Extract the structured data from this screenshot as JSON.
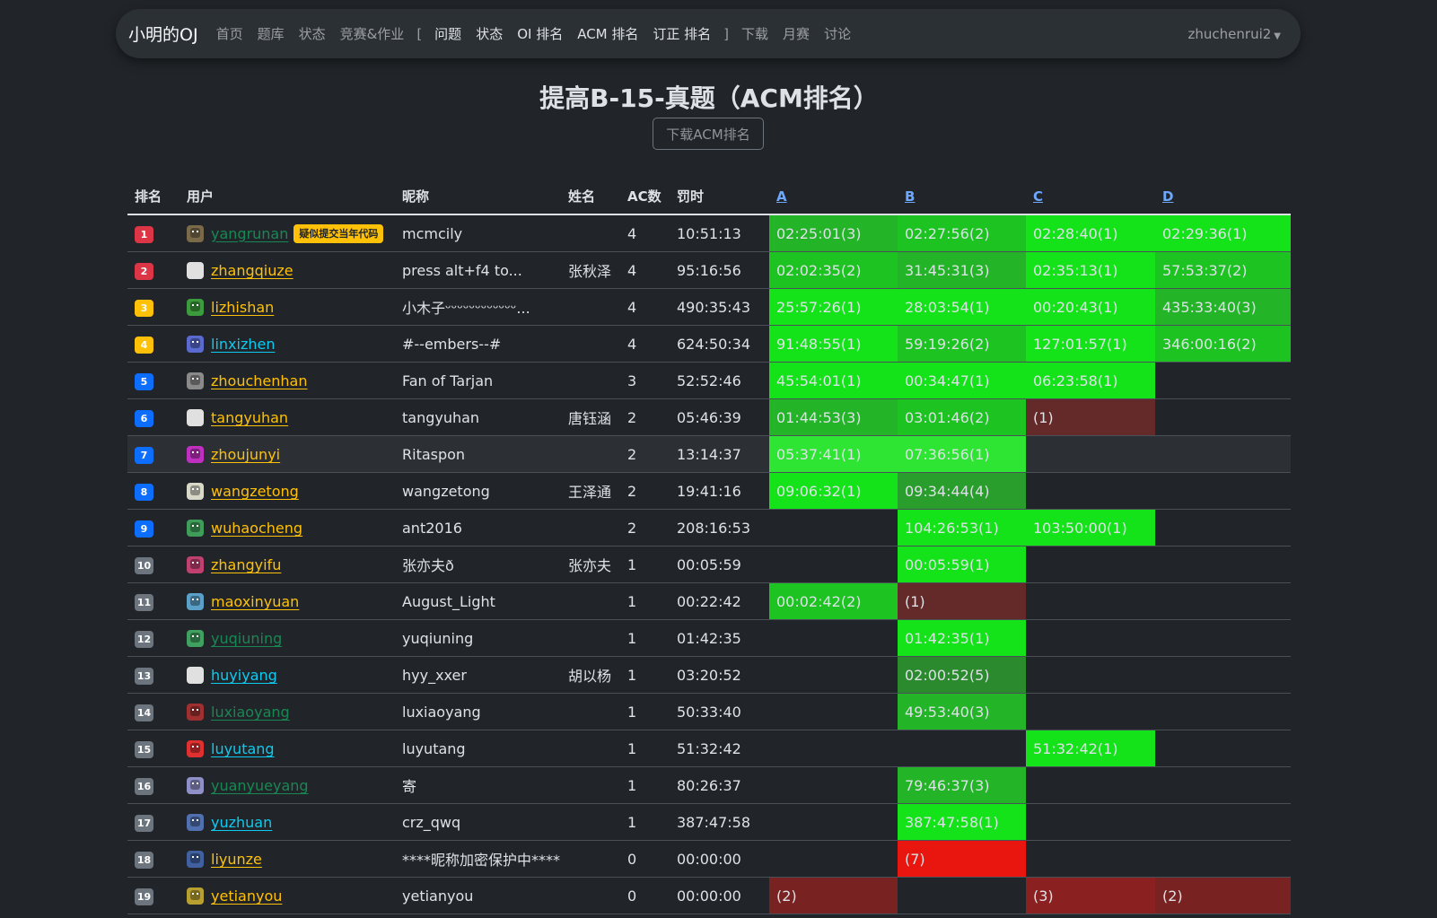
{
  "nav": {
    "brand": "小明的OJ",
    "items": [
      {
        "label": "首页",
        "strong": false
      },
      {
        "label": "题库",
        "strong": false
      },
      {
        "label": "状态",
        "strong": false
      },
      {
        "label": "竞赛&作业",
        "strong": false
      },
      {
        "label": "[",
        "bracket": true
      },
      {
        "label": "问题",
        "strong": true
      },
      {
        "label": "状态",
        "strong": true
      },
      {
        "label": "OI 排名",
        "strong": true
      },
      {
        "label": "ACM 排名",
        "strong": true
      },
      {
        "label": "订正 排名",
        "strong": true
      },
      {
        "label": "]",
        "bracket": true
      },
      {
        "label": "下载",
        "strong": false
      },
      {
        "label": "月赛",
        "strong": false
      },
      {
        "label": "讨论",
        "strong": false
      }
    ],
    "user": "zhuchenrui2"
  },
  "page": {
    "title": "提高B-15-真题（ACM排名）",
    "download_label": "下载ACM排名"
  },
  "table": {
    "headers": {
      "rank": "排名",
      "user": "用户",
      "nick": "昵称",
      "name": "姓名",
      "ac": "AC数",
      "penalty": "罚时"
    },
    "problems": [
      "A",
      "B",
      "C",
      "D"
    ],
    "rows": [
      {
        "rank": "1",
        "user": "yangrunan",
        "ucolor": "#198754",
        "avatar": "#7a6a4a",
        "flag": "疑似提交当年代码",
        "nick": "mcmcily",
        "name": "",
        "ac": "4",
        "pen": "10:51:13",
        "cells": [
          {
            "t": "02:25:01(3)",
            "c": "#23b428"
          },
          {
            "t": "02:27:56(2)",
            "c": "#1cc321"
          },
          {
            "t": "02:28:40(1)",
            "c": "#14e31a"
          },
          {
            "t": "02:29:36(1)",
            "c": "#14e31a"
          }
        ]
      },
      {
        "rank": "2",
        "user": "zhangqiuze",
        "ucolor": "#ffc107",
        "avatar": "#e0e0e0",
        "avatarPlain": true,
        "nick": "press alt+f4 to...",
        "name": "张秋泽",
        "ac": "4",
        "pen": "95:16:56",
        "cells": [
          {
            "t": "02:02:35(2)",
            "c": "#1cc321"
          },
          {
            "t": "31:45:31(3)",
            "c": "#23b428"
          },
          {
            "t": "02:35:13(1)",
            "c": "#14e31a"
          },
          {
            "t": "57:53:37(2)",
            "c": "#1cc321"
          }
        ]
      },
      {
        "rank": "3",
        "user": "lizhishan",
        "ucolor": "#ffc107",
        "avatar": "#3c9b3c",
        "nick": "小木子ᵕᵕᵕᵕᵕᵕᵕᵕᵕᵕᵕᵕ...",
        "name": "",
        "ac": "4",
        "pen": "490:35:43",
        "cells": [
          {
            "t": "25:57:26(1)",
            "c": "#14e31a"
          },
          {
            "t": "28:03:54(1)",
            "c": "#14e31a"
          },
          {
            "t": "00:20:43(1)",
            "c": "#14e31a"
          },
          {
            "t": "435:33:40(3)",
            "c": "#23b428"
          }
        ]
      },
      {
        "rank": "4",
        "user": "linxizhen",
        "ucolor": "#0dcaf0",
        "avatar": "#5a6ad0",
        "nick": "#--embers--#",
        "name": "",
        "ac": "4",
        "pen": "624:50:34",
        "cells": [
          {
            "t": "91:48:55(1)",
            "c": "#14e31a"
          },
          {
            "t": "59:19:26(2)",
            "c": "#1cc321"
          },
          {
            "t": "127:01:57(1)",
            "c": "#14e31a"
          },
          {
            "t": "346:00:16(2)",
            "c": "#1cc321"
          }
        ]
      },
      {
        "rank": "5",
        "user": "zhouchenhan",
        "ucolor": "#ffc107",
        "avatar": "#8a8a8a",
        "nick": "Fan of Tarjan",
        "name": "",
        "ac": "3",
        "pen": "52:52:46",
        "cells": [
          {
            "t": "45:54:01(1)",
            "c": "#14e31a"
          },
          {
            "t": "00:34:47(1)",
            "c": "#14e31a"
          },
          {
            "t": "06:23:58(1)",
            "c": "#14e31a"
          },
          {
            "t": "",
            "c": ""
          }
        ]
      },
      {
        "rank": "6",
        "user": "tangyuhan",
        "ucolor": "#ffc107",
        "avatar": "#e0e0e0",
        "avatarPlain": true,
        "nick": "tangyuhan",
        "name": "唐钰涵",
        "ac": "2",
        "pen": "05:46:39",
        "cells": [
          {
            "t": "01:44:53(3)",
            "c": "#23b428"
          },
          {
            "t": "03:01:46(2)",
            "c": "#1cc321"
          },
          {
            "t": "(1)",
            "c": "#642a2a"
          },
          {
            "t": "",
            "c": ""
          }
        ]
      },
      {
        "rank": "7",
        "user": "zhoujunyi",
        "ucolor": "#ffc107",
        "avatar": "#c030c0",
        "hl": true,
        "nick": "Ritaspon",
        "name": "",
        "ac": "2",
        "pen": "13:14:37",
        "cells": [
          {
            "t": "05:37:41(1)",
            "c": "#2ee533"
          },
          {
            "t": "07:36:56(1)",
            "c": "#2ee533"
          },
          {
            "t": "",
            "c": ""
          },
          {
            "t": "",
            "c": ""
          }
        ]
      },
      {
        "rank": "8",
        "user": "wangzetong",
        "ucolor": "#ffc107",
        "avatar": "#d8d8c8",
        "nick": "wangzetong",
        "name": "王泽通",
        "ac": "2",
        "pen": "19:41:16",
        "cells": [
          {
            "t": "09:06:32(1)",
            "c": "#14e31a"
          },
          {
            "t": "09:34:44(4)",
            "c": "#2a9e2d"
          },
          {
            "t": "",
            "c": ""
          },
          {
            "t": "",
            "c": ""
          }
        ]
      },
      {
        "rank": "9",
        "user": "wuhaocheng",
        "ucolor": "#ffc107",
        "avatar": "#3f9d5a",
        "nick": "ant2016",
        "name": "",
        "ac": "2",
        "pen": "208:16:53",
        "cells": [
          {
            "t": "",
            "c": ""
          },
          {
            "t": "104:26:53(1)",
            "c": "#14e31a"
          },
          {
            "t": "103:50:00(1)",
            "c": "#14e31a"
          },
          {
            "t": "",
            "c": ""
          }
        ]
      },
      {
        "rank": "10",
        "user": "zhangyifu",
        "ucolor": "#ffc107",
        "avatar": "#c04070",
        "nick": "张亦夫ð",
        "name": "张亦夫",
        "ac": "1",
        "pen": "00:05:59",
        "cells": [
          {
            "t": "",
            "c": ""
          },
          {
            "t": "00:05:59(1)",
            "c": "#14e31a"
          },
          {
            "t": "",
            "c": ""
          },
          {
            "t": "",
            "c": ""
          }
        ]
      },
      {
        "rank": "11",
        "user": "maoxinyuan",
        "ucolor": "#ffc107",
        "avatar": "#5aa0c8",
        "nick": "August_Light",
        "name": "",
        "ac": "1",
        "pen": "00:22:42",
        "cells": [
          {
            "t": "00:02:42(2)",
            "c": "#1cc321"
          },
          {
            "t": "(1)",
            "c": "#642a2a"
          },
          {
            "t": "",
            "c": ""
          },
          {
            "t": "",
            "c": ""
          }
        ]
      },
      {
        "rank": "12",
        "user": "yuqiuning",
        "ucolor": "#198754",
        "avatar": "#3fa060",
        "nick": "yuqiuning",
        "name": "",
        "ac": "1",
        "pen": "01:42:35",
        "cells": [
          {
            "t": "",
            "c": ""
          },
          {
            "t": "01:42:35(1)",
            "c": "#14e31a"
          },
          {
            "t": "",
            "c": ""
          },
          {
            "t": "",
            "c": ""
          }
        ]
      },
      {
        "rank": "13",
        "user": "huyiyang",
        "ucolor": "#0dcaf0",
        "avatar": "#e0e0e0",
        "avatarPlain": true,
        "nick": "hyy_xxer",
        "name": "胡以杨",
        "ac": "1",
        "pen": "03:20:52",
        "cells": [
          {
            "t": "",
            "c": ""
          },
          {
            "t": "02:00:52(5)",
            "c": "#2a8a2d"
          },
          {
            "t": "",
            "c": ""
          },
          {
            "t": "",
            "c": ""
          }
        ]
      },
      {
        "rank": "14",
        "user": "luxiaoyang",
        "ucolor": "#198754",
        "avatar": "#a03030",
        "nick": "luxiaoyang",
        "name": "",
        "ac": "1",
        "pen": "50:33:40",
        "cells": [
          {
            "t": "",
            "c": ""
          },
          {
            "t": "49:53:40(3)",
            "c": "#23b428"
          },
          {
            "t": "",
            "c": ""
          },
          {
            "t": "",
            "c": ""
          }
        ]
      },
      {
        "rank": "15",
        "user": "luyutang",
        "ucolor": "#0dcaf0",
        "avatar": "#e03030",
        "nick": "luyutang",
        "name": "",
        "ac": "1",
        "pen": "51:32:42",
        "cells": [
          {
            "t": "",
            "c": ""
          },
          {
            "t": "",
            "c": ""
          },
          {
            "t": "51:32:42(1)",
            "c": "#14e31a"
          },
          {
            "t": "",
            "c": ""
          }
        ]
      },
      {
        "rank": "16",
        "user": "yuanyueyang",
        "ucolor": "#198754",
        "avatar": "#9090c8",
        "nick": "寄",
        "name": "",
        "ac": "1",
        "pen": "80:26:37",
        "cells": [
          {
            "t": "",
            "c": ""
          },
          {
            "t": "79:46:37(3)",
            "c": "#23b428"
          },
          {
            "t": "",
            "c": ""
          },
          {
            "t": "",
            "c": ""
          }
        ]
      },
      {
        "rank": "17",
        "user": "yuzhuan",
        "ucolor": "#0dcaf0",
        "avatar": "#5070b0",
        "nick": "crz_qwq",
        "name": "",
        "ac": "1",
        "pen": "387:47:58",
        "cells": [
          {
            "t": "",
            "c": ""
          },
          {
            "t": "387:47:58(1)",
            "c": "#14e31a"
          },
          {
            "t": "",
            "c": ""
          },
          {
            "t": "",
            "c": ""
          }
        ]
      },
      {
        "rank": "18",
        "user": "liyunze",
        "ucolor": "#ffc107",
        "avatar": "#4060a0",
        "nick": "****昵称加密保护中****",
        "name": "",
        "ac": "0",
        "pen": "00:00:00",
        "cells": [
          {
            "t": "",
            "c": ""
          },
          {
            "t": "(7)",
            "c": "#e8160f"
          },
          {
            "t": "",
            "c": ""
          },
          {
            "t": "",
            "c": ""
          }
        ]
      },
      {
        "rank": "19",
        "user": "yetianyou",
        "ucolor": "#ffc107",
        "avatar": "#b8a030",
        "nick": "yetianyou",
        "name": "",
        "ac": "0",
        "pen": "00:00:00",
        "cells": [
          {
            "t": "(2)",
            "c": "#782222"
          },
          {
            "t": "",
            "c": ""
          },
          {
            "t": "(3)",
            "c": "#8a2020"
          },
          {
            "t": "(2)",
            "c": "#782222"
          }
        ]
      }
    ]
  }
}
